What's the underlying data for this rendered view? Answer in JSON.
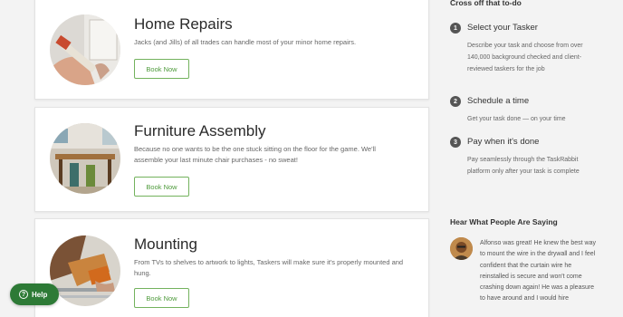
{
  "categories": [
    {
      "title": "Home Repairs",
      "description": "Jacks (and Jills) of all trades can handle most of your minor home repairs.",
      "button": "Book Now",
      "image": "home-repairs-photo"
    },
    {
      "title": "Furniture Assembly",
      "description": "Because no one wants to be the one stuck sitting on the floor for the game. We'll assemble your last minute chair purchases - no sweat!",
      "button": "Book Now",
      "image": "furniture-assembly-photo"
    },
    {
      "title": "Mounting",
      "description": "From TVs to shelves to artwork to lights, Taskers will make sure it's properly mounted and hung.",
      "button": "Book Now",
      "image": "mounting-photo"
    }
  ],
  "sidebar": {
    "heading": "Cross off that to-do",
    "steps": [
      {
        "number": "1",
        "title": "Select your Tasker",
        "description": "Describe your task and choose from over 140,000 background checked and client-reviewed taskers for the job"
      },
      {
        "number": "2",
        "title": "Schedule a time",
        "description": "Get your task done — on your time"
      },
      {
        "number": "3",
        "title": "Pay when it's done",
        "description": "Pay seamlessly through the TaskRabbit platform only after your task is complete"
      }
    ],
    "reviews_heading": "Hear What People Are Saying",
    "review": "Alfonso was great! He knew the best way to mount the wire in the drywall and I feel confident that the curtain wire he reinstalled is secure and won't come crashing down again! He was a pleasure to have around and I would hire"
  },
  "help": {
    "label": "Help",
    "icon": "question-icon"
  },
  "colors": {
    "accent": "#73b25d",
    "help": "#2d7a36"
  }
}
